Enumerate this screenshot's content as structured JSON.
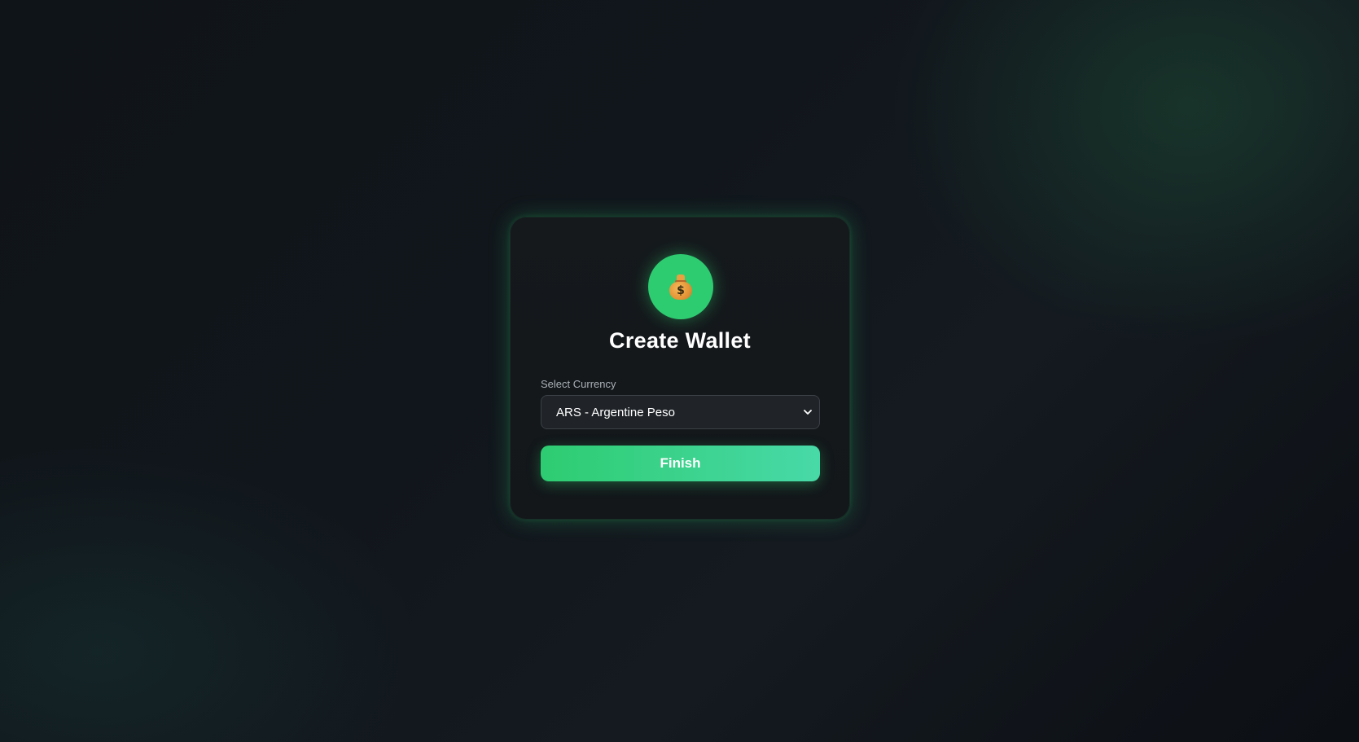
{
  "card": {
    "icon": "money-bag-icon",
    "title": "Create Wallet"
  },
  "currency": {
    "label": "Select Currency",
    "selected": "ARS - Argentine Peso"
  },
  "actions": {
    "finish_label": "Finish"
  },
  "colors": {
    "accent": "#2ecc71",
    "accent_end": "#48d9a8",
    "card_bg": "#15191c",
    "page_bg": "#11161c"
  }
}
